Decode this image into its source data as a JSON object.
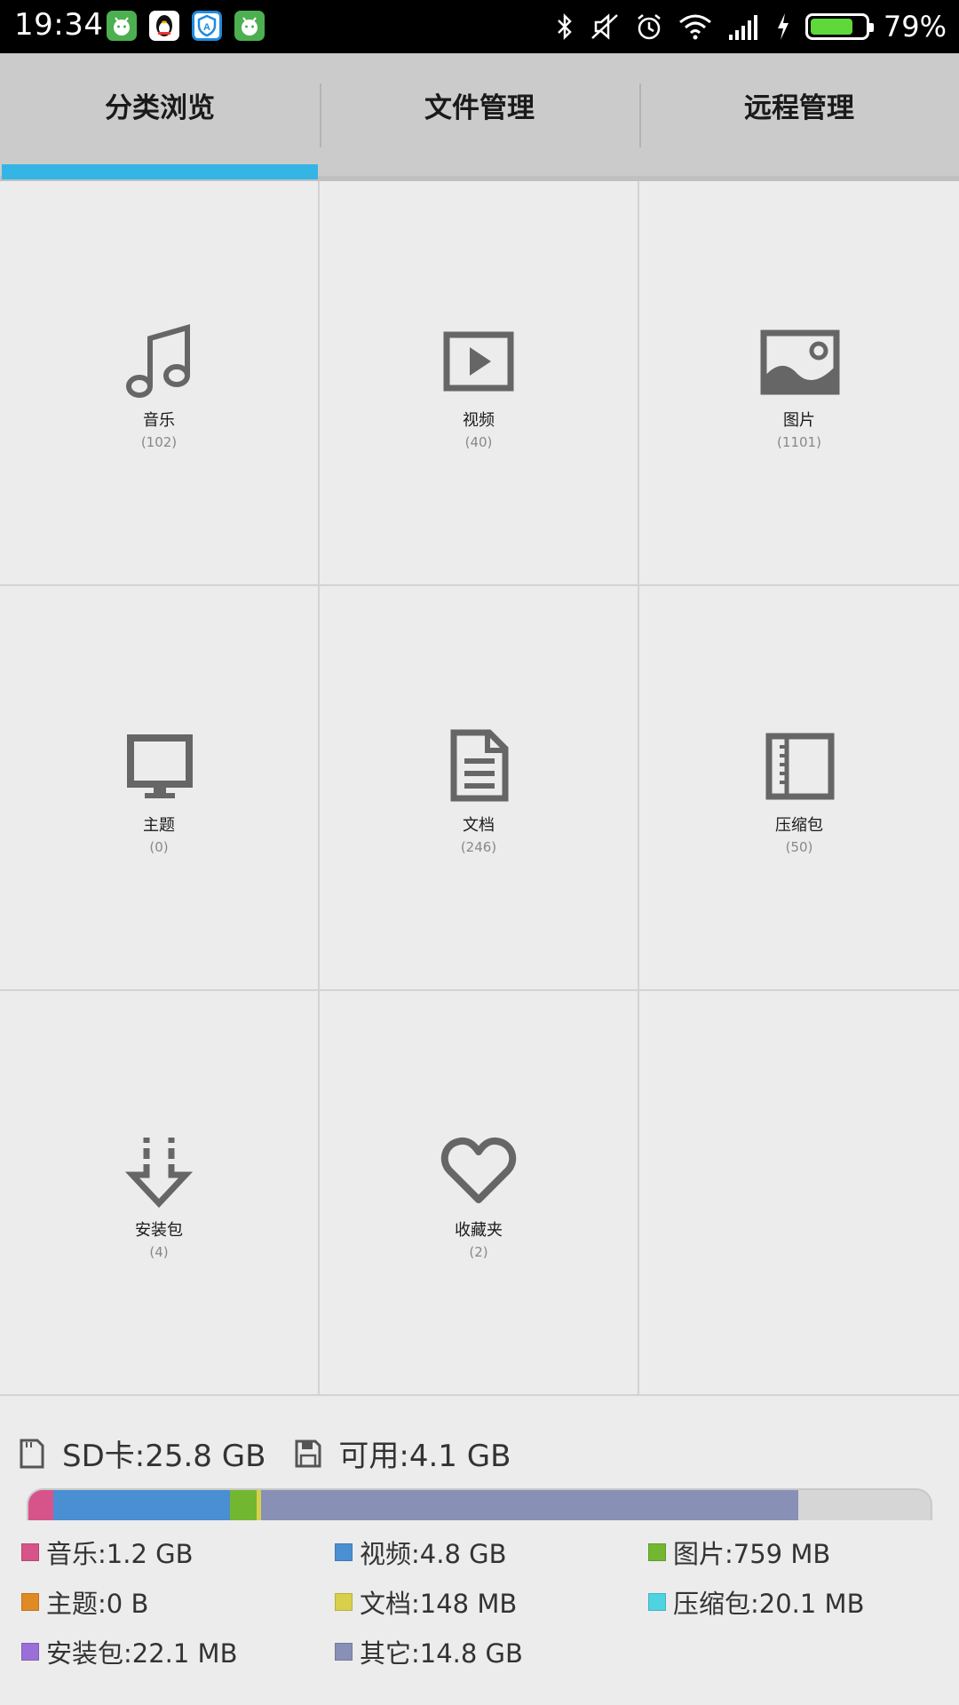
{
  "status_bar": {
    "time": "19:34",
    "battery_percent": "79%",
    "battery_level": 0.79,
    "notification_icons": [
      "android-app-icon",
      "qq-penguin-icon",
      "security-shield-icon",
      "android-app-icon"
    ],
    "system_icons": [
      "bluetooth-icon",
      "silent-icon",
      "alarm-icon",
      "wifi-icon",
      "signal-icon",
      "charging-icon",
      "battery-icon"
    ]
  },
  "tabs": [
    {
      "label": "分类浏览",
      "active": true
    },
    {
      "label": "文件管理",
      "active": false
    },
    {
      "label": "远程管理",
      "active": false
    }
  ],
  "accent_color": "#35b5e5",
  "categories": [
    {
      "label": "音乐",
      "count": "(102)",
      "icon": "music-note-icon"
    },
    {
      "label": "视频",
      "count": "(40)",
      "icon": "video-play-icon"
    },
    {
      "label": "图片",
      "count": "(1101)",
      "icon": "picture-icon"
    },
    {
      "label": "主题",
      "count": "(0)",
      "icon": "monitor-icon"
    },
    {
      "label": "文档",
      "count": "(246)",
      "icon": "document-icon"
    },
    {
      "label": "压缩包",
      "count": "(50)",
      "icon": "archive-icon"
    },
    {
      "label": "安装包",
      "count": "(4)",
      "icon": "install-download-icon"
    },
    {
      "label": "收藏夹",
      "count": "(2)",
      "icon": "heart-icon"
    }
  ],
  "storage": {
    "sd_label": "SD卡:25.8 GB",
    "available_label": "可用:4.1 GB",
    "usage_bar": [
      {
        "name": "music",
        "fraction": 0.028,
        "color": "#d6548a"
      },
      {
        "name": "video",
        "fraction": 0.195,
        "color": "#4a8fd1"
      },
      {
        "name": "pictures",
        "fraction": 0.03,
        "color": "#73b731"
      },
      {
        "name": "docs",
        "fraction": 0.005,
        "color": "#d8d04a"
      },
      {
        "name": "other",
        "fraction": 0.595,
        "color": "#8890b6"
      }
    ],
    "legend": [
      {
        "label": "音乐:1.2 GB",
        "color": "#d6548a"
      },
      {
        "label": "视频:4.8 GB",
        "color": "#4a8fd1"
      },
      {
        "label": "图片:759 MB",
        "color": "#73b731"
      },
      {
        "label": "主题:0 B",
        "color": "#e08a25"
      },
      {
        "label": "文档:148 MB",
        "color": "#d8d04a"
      },
      {
        "label": "压缩包:20.1 MB",
        "color": "#4fd3e0"
      },
      {
        "label": "安装包:22.1 MB",
        "color": "#9b6fd8"
      },
      {
        "label": "其它:14.8 GB",
        "color": "#8890b6"
      }
    ]
  }
}
